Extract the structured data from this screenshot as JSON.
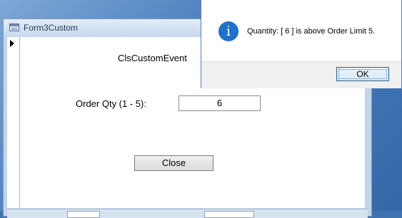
{
  "form_window": {
    "title": "Form3Custom",
    "icon": "form-icon"
  },
  "form": {
    "heading": "ClsCustomEvent",
    "qty_label": "Order Qty (1 - 5):",
    "qty_value": "6",
    "close_label": "Close"
  },
  "message_box": {
    "icon": "info-icon",
    "icon_glyph": "i",
    "text": "Quantity: [ 6 ] is above Order Limit 5.",
    "ok_label": "OK"
  },
  "colors": {
    "desktop": "#3f73b0",
    "info_icon": "#1e70c8"
  }
}
